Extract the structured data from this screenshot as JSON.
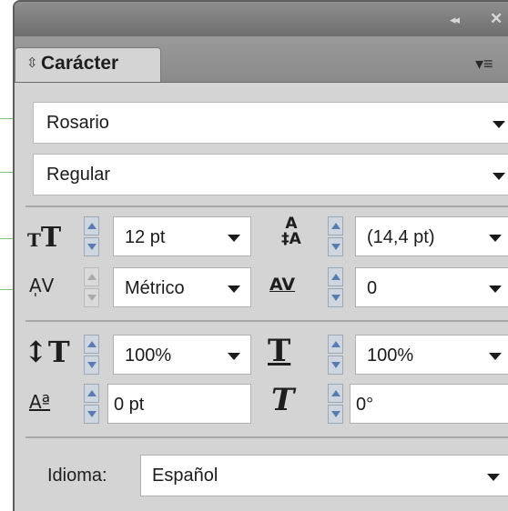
{
  "window": {
    "collapse_glyph": "◂◂",
    "close_glyph": "✕"
  },
  "tab": {
    "label": "Carácter",
    "sort_glyph": "⇳"
  },
  "panel_menu_glyph": "▾≡",
  "font_family": {
    "value": "Rosario"
  },
  "font_style": {
    "value": "Regular"
  },
  "size": {
    "value": "12 pt"
  },
  "leading": {
    "value": "(14,4 pt)"
  },
  "kerning": {
    "value": "Métrico"
  },
  "tracking": {
    "value": "0"
  },
  "vertical_scale": {
    "value": "100%"
  },
  "horizontal_scale": {
    "value": "100%"
  },
  "baseline_shift": {
    "value": "0 pt"
  },
  "rotation": {
    "value": "0°"
  },
  "language": {
    "label": "Idioma:",
    "value": "Español"
  },
  "icons": {
    "font_size": "font-size-icon",
    "leading": "leading-icon",
    "kerning": "kerning-icon",
    "tracking": "tracking-icon",
    "vertical_scale": "vertical-scale-icon",
    "horizontal_scale": "horizontal-scale-icon",
    "baseline_shift": "baseline-shift-icon",
    "rotation": "character-rotation-icon"
  },
  "colors": {
    "titlebar": "#7e7e7e",
    "panel_bg": "#d4d4d4",
    "spinner_accent": "#5b7cb0",
    "callout_line": "#7fc47f"
  }
}
